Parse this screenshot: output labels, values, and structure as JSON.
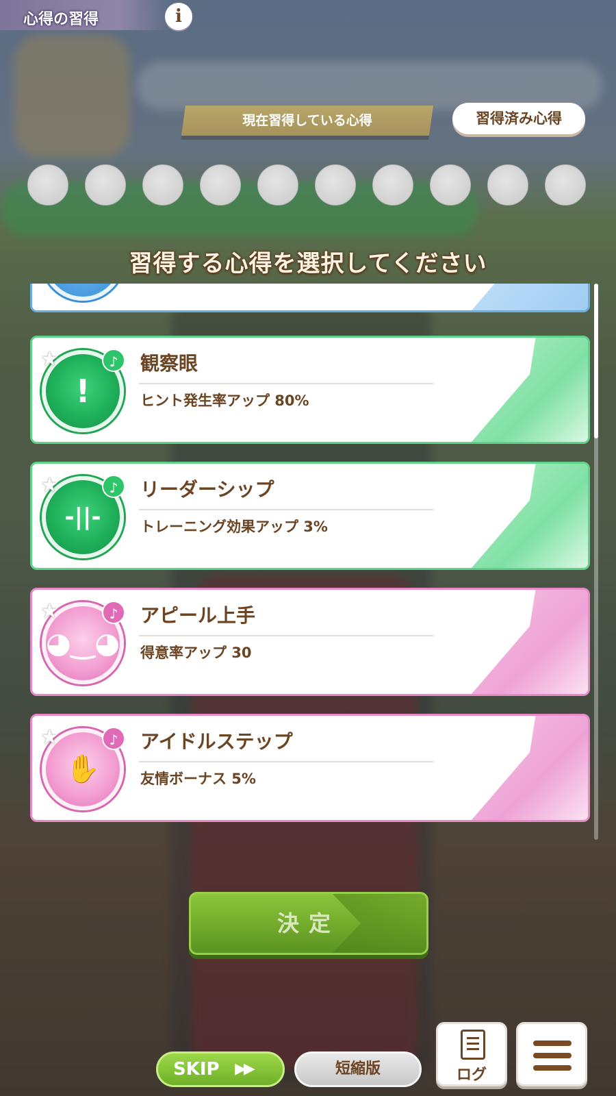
{
  "header": {
    "title": "心得の習得",
    "info_label": "i"
  },
  "tabs": {
    "current_label": "現在習得している心得",
    "learned_label": "習得済み心得"
  },
  "slots": {
    "count": 10
  },
  "prompt": "習得する心得を選択してください",
  "hints": [
    {
      "name": "観察眼",
      "description": "ヒント発生率アップ 80%",
      "color": "#2ec46a",
      "icon": "hint-exclamation-icon",
      "badge": "♪"
    },
    {
      "name": "リーダーシップ",
      "description": "トレーニング効果アップ 3%",
      "color": "#2ec46a",
      "icon": "dumbbell-icon",
      "badge": "♪"
    },
    {
      "name": "アピール上手",
      "description": "得意率アップ 30",
      "color": "#e16ab6",
      "icon": "rabbit-icon",
      "badge": "♪"
    },
    {
      "name": "アイドルステップ",
      "description": "友情ボーナス 5%",
      "color": "#e16ab6",
      "icon": "handshake-icon",
      "badge": "♪"
    }
  ],
  "confirm": {
    "label": "決定"
  },
  "controls": {
    "skip_label": "SKIP",
    "skip_arrows": "▶▶",
    "short_label": "短縮版",
    "log_label": "ログ",
    "menu_icon": "hamburger-menu-icon"
  }
}
